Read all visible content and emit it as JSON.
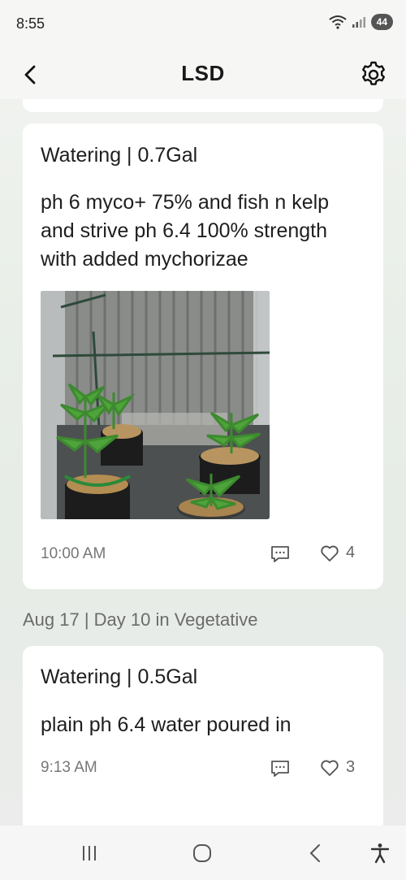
{
  "status": {
    "time": "8:55",
    "battery": "44"
  },
  "header": {
    "title": "LSD"
  },
  "posts": [
    {
      "title": "Watering | 0.7Gal",
      "body": "ph 6 myco+ 75% and fish n kelp and strive ph 6.4 100% strength with added mychorizae",
      "time": "10:00 AM",
      "likes": "4"
    },
    {
      "title": "Watering | 0.5Gal",
      "body": "plain ph 6.4 water poured in",
      "time": "9:13 AM",
      "likes": "3"
    }
  ],
  "section": {
    "date_label": "Aug 17 | Day 10 in Vegetative"
  },
  "icons": {
    "back": "chevron-left-icon",
    "settings": "gear-icon",
    "comment": "comment-icon",
    "like": "heart-icon",
    "nav_recents": "recents-icon",
    "nav_home": "home-icon",
    "nav_back": "back-icon",
    "nav_accessibility": "accessibility-icon"
  }
}
